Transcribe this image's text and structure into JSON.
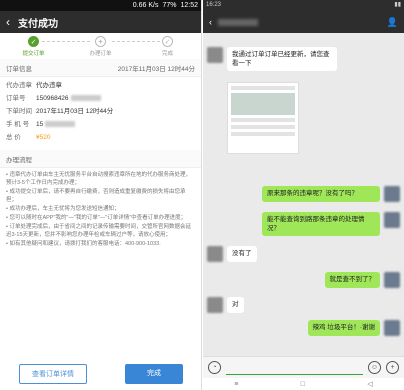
{
  "left": {
    "status": {
      "left": "",
      "speed": "0.66 K/s",
      "battery": "77%",
      "time": "12:52"
    },
    "title": "支付成功",
    "steps": [
      "提交订单",
      "办理订单",
      "完成"
    ],
    "order_info": {
      "section_label": "订单信息",
      "datetime": "2017年11月03日 12时44分",
      "rows": [
        {
          "k": "代办违章",
          "v": "代办违章"
        },
        {
          "k": "订单号",
          "v": "150968426"
        },
        {
          "k": "下单时间",
          "v": "2017年11月03日 12时44分"
        },
        {
          "k": "手 机 号",
          "v": "15"
        },
        {
          "k": "总  价",
          "v": "¥520"
        }
      ]
    },
    "flow_title": "办理流程",
    "flow_lines": [
      "• 违章代办订单由车主无忧服务平台自动搜索违章所在地的代办服务商处理，预计3-5个工作日内完成办理；",
      "• 成功提交订单后，请不要再自行缴费，否则造成重复缴费的损失将由您承担；",
      "• 成功办理后，车主无忧将为您发送短信通知；",
      "• 您可以随时在APP\"我的\"—\"我的订单\"—\"订单详情\"中查看订单办理进度；",
      "• 订单处理完成后，由于省间之间的记录传输需要时间，交管所官网数据会延迟3-15天更新，您并不影响您办理年检或车辆过户等，请放心使用；",
      "• 如有其他疑问和建议，请拨打我们的客服电话：400-900-1033."
    ],
    "btn_detail": "查看订单详情",
    "btn_done": "完成"
  },
  "right": {
    "status": {
      "time": "16:23"
    },
    "time_label": "",
    "messages": [
      {
        "side": "in",
        "text": "我通过订单订单已经更新，请您查看一下"
      },
      {
        "side": "out",
        "text": "原来那条的违章呢？没有了吗？"
      },
      {
        "side": "out",
        "text": "能不能查询到路那条违章的处理情况？"
      },
      {
        "side": "in",
        "text": "没有了"
      },
      {
        "side": "out",
        "text": "就是查不到了？"
      },
      {
        "side": "in",
        "text": "对"
      },
      {
        "side": "out",
        "text": "辣鸡 垃圾平台！·谢谢"
      }
    ]
  }
}
